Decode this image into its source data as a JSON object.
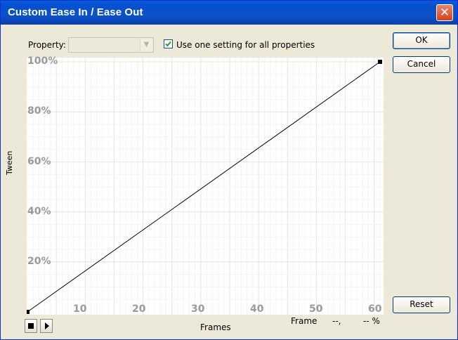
{
  "window": {
    "title": "Custom Ease In / Ease Out"
  },
  "toolbar": {
    "property_label": "Property:",
    "property_value": "",
    "use_one_setting_label": "Use one setting for all properties",
    "use_one_setting_checked": true
  },
  "buttons": {
    "ok": "OK",
    "cancel": "Cancel",
    "reset": "Reset"
  },
  "chart_data": {
    "type": "line",
    "xlabel": "Frames",
    "ylabel": "Tween",
    "x_ticks": [
      "10",
      "20",
      "30",
      "40",
      "50",
      "60"
    ],
    "y_ticks": [
      "20%",
      "40%",
      "60%",
      "80%",
      "100%"
    ],
    "xlim": [
      0,
      61
    ],
    "ylim": [
      0,
      100
    ],
    "grid": true,
    "series": [
      {
        "points": [
          [
            0,
            0
          ],
          [
            61,
            100
          ]
        ]
      }
    ]
  },
  "status": {
    "frame_label": "Frame",
    "frame_value": "--,",
    "percent_value": "-- %"
  },
  "icons": {
    "stop": "stop-icon",
    "play": "play-icon",
    "close": "close-icon"
  },
  "colors": {
    "titlebar": "#0a4fd0",
    "dialog_bg": "#ECE9D8",
    "plot_bg": "#ffffff",
    "curve": "#000000"
  }
}
